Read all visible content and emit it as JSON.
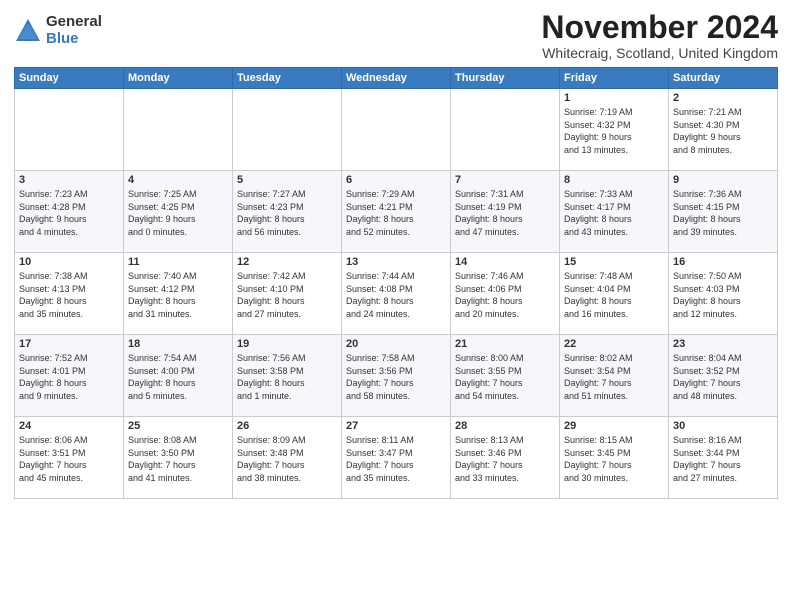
{
  "logo": {
    "general": "General",
    "blue": "Blue"
  },
  "header": {
    "title": "November 2024",
    "subtitle": "Whitecraig, Scotland, United Kingdom"
  },
  "weekdays": [
    "Sunday",
    "Monday",
    "Tuesday",
    "Wednesday",
    "Thursday",
    "Friday",
    "Saturday"
  ],
  "weeks": [
    [
      {
        "day": "",
        "info": ""
      },
      {
        "day": "",
        "info": ""
      },
      {
        "day": "",
        "info": ""
      },
      {
        "day": "",
        "info": ""
      },
      {
        "day": "",
        "info": ""
      },
      {
        "day": "1",
        "info": "Sunrise: 7:19 AM\nSunset: 4:32 PM\nDaylight: 9 hours\nand 13 minutes."
      },
      {
        "day": "2",
        "info": "Sunrise: 7:21 AM\nSunset: 4:30 PM\nDaylight: 9 hours\nand 8 minutes."
      }
    ],
    [
      {
        "day": "3",
        "info": "Sunrise: 7:23 AM\nSunset: 4:28 PM\nDaylight: 9 hours\nand 4 minutes."
      },
      {
        "day": "4",
        "info": "Sunrise: 7:25 AM\nSunset: 4:25 PM\nDaylight: 9 hours\nand 0 minutes."
      },
      {
        "day": "5",
        "info": "Sunrise: 7:27 AM\nSunset: 4:23 PM\nDaylight: 8 hours\nand 56 minutes."
      },
      {
        "day": "6",
        "info": "Sunrise: 7:29 AM\nSunset: 4:21 PM\nDaylight: 8 hours\nand 52 minutes."
      },
      {
        "day": "7",
        "info": "Sunrise: 7:31 AM\nSunset: 4:19 PM\nDaylight: 8 hours\nand 47 minutes."
      },
      {
        "day": "8",
        "info": "Sunrise: 7:33 AM\nSunset: 4:17 PM\nDaylight: 8 hours\nand 43 minutes."
      },
      {
        "day": "9",
        "info": "Sunrise: 7:36 AM\nSunset: 4:15 PM\nDaylight: 8 hours\nand 39 minutes."
      }
    ],
    [
      {
        "day": "10",
        "info": "Sunrise: 7:38 AM\nSunset: 4:13 PM\nDaylight: 8 hours\nand 35 minutes."
      },
      {
        "day": "11",
        "info": "Sunrise: 7:40 AM\nSunset: 4:12 PM\nDaylight: 8 hours\nand 31 minutes."
      },
      {
        "day": "12",
        "info": "Sunrise: 7:42 AM\nSunset: 4:10 PM\nDaylight: 8 hours\nand 27 minutes."
      },
      {
        "day": "13",
        "info": "Sunrise: 7:44 AM\nSunset: 4:08 PM\nDaylight: 8 hours\nand 24 minutes."
      },
      {
        "day": "14",
        "info": "Sunrise: 7:46 AM\nSunset: 4:06 PM\nDaylight: 8 hours\nand 20 minutes."
      },
      {
        "day": "15",
        "info": "Sunrise: 7:48 AM\nSunset: 4:04 PM\nDaylight: 8 hours\nand 16 minutes."
      },
      {
        "day": "16",
        "info": "Sunrise: 7:50 AM\nSunset: 4:03 PM\nDaylight: 8 hours\nand 12 minutes."
      }
    ],
    [
      {
        "day": "17",
        "info": "Sunrise: 7:52 AM\nSunset: 4:01 PM\nDaylight: 8 hours\nand 9 minutes."
      },
      {
        "day": "18",
        "info": "Sunrise: 7:54 AM\nSunset: 4:00 PM\nDaylight: 8 hours\nand 5 minutes."
      },
      {
        "day": "19",
        "info": "Sunrise: 7:56 AM\nSunset: 3:58 PM\nDaylight: 8 hours\nand 1 minute."
      },
      {
        "day": "20",
        "info": "Sunrise: 7:58 AM\nSunset: 3:56 PM\nDaylight: 7 hours\nand 58 minutes."
      },
      {
        "day": "21",
        "info": "Sunrise: 8:00 AM\nSunset: 3:55 PM\nDaylight: 7 hours\nand 54 minutes."
      },
      {
        "day": "22",
        "info": "Sunrise: 8:02 AM\nSunset: 3:54 PM\nDaylight: 7 hours\nand 51 minutes."
      },
      {
        "day": "23",
        "info": "Sunrise: 8:04 AM\nSunset: 3:52 PM\nDaylight: 7 hours\nand 48 minutes."
      }
    ],
    [
      {
        "day": "24",
        "info": "Sunrise: 8:06 AM\nSunset: 3:51 PM\nDaylight: 7 hours\nand 45 minutes."
      },
      {
        "day": "25",
        "info": "Sunrise: 8:08 AM\nSunset: 3:50 PM\nDaylight: 7 hours\nand 41 minutes."
      },
      {
        "day": "26",
        "info": "Sunrise: 8:09 AM\nSunset: 3:48 PM\nDaylight: 7 hours\nand 38 minutes."
      },
      {
        "day": "27",
        "info": "Sunrise: 8:11 AM\nSunset: 3:47 PM\nDaylight: 7 hours\nand 35 minutes."
      },
      {
        "day": "28",
        "info": "Sunrise: 8:13 AM\nSunset: 3:46 PM\nDaylight: 7 hours\nand 33 minutes."
      },
      {
        "day": "29",
        "info": "Sunrise: 8:15 AM\nSunset: 3:45 PM\nDaylight: 7 hours\nand 30 minutes."
      },
      {
        "day": "30",
        "info": "Sunrise: 8:16 AM\nSunset: 3:44 PM\nDaylight: 7 hours\nand 27 minutes."
      }
    ]
  ]
}
